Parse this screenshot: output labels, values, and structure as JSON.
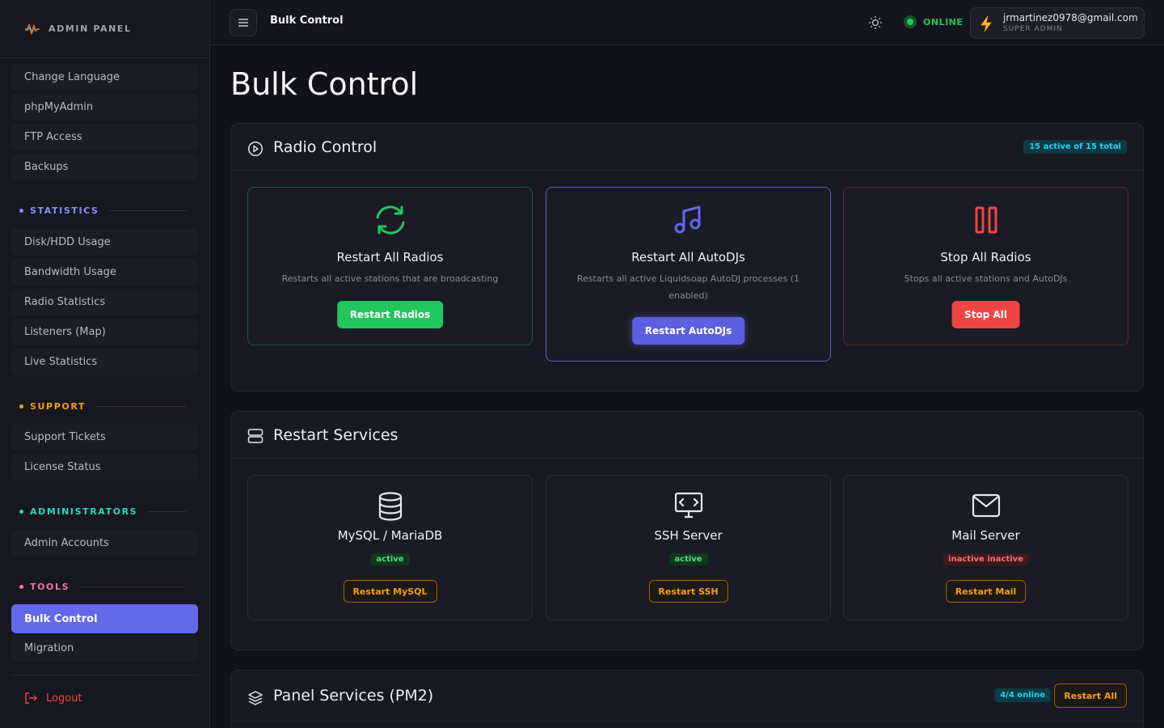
{
  "sidebar": {
    "brand": "ADMIN PANEL",
    "items_top": [
      "Change Language",
      "phpMyAdmin",
      "FTP Access",
      "Backups"
    ],
    "sections": {
      "statistics": {
        "label": "STATISTICS",
        "color": "#8b8ff5",
        "items": [
          "Disk/HDD Usage",
          "Bandwidth Usage",
          "Radio Statistics",
          "Listeners (Map)",
          "Live Statistics"
        ]
      },
      "support": {
        "label": "SUPPORT",
        "color": "#f59e0b",
        "items": [
          "Support Tickets",
          "License Status"
        ]
      },
      "administrators": {
        "label": "ADMINISTRATORS",
        "color": "#2dd4bf",
        "items": [
          "Admin Accounts"
        ]
      },
      "tools": {
        "label": "TOOLS",
        "color": "#f472b6",
        "items": [
          "Bulk Control",
          "Migration"
        ]
      }
    },
    "logout": "Logout"
  },
  "topbar": {
    "title": "Bulk Control",
    "status": "ONLINE",
    "user_email": "jrmartinez0978@gmail.com",
    "user_role": "SUPER ADMIN"
  },
  "page": {
    "title": "Bulk Control"
  },
  "radio_control": {
    "title": "Radio Control",
    "badge": "15 active of 15 total",
    "cards": [
      {
        "title": "Restart All Radios",
        "desc": "Restarts all active stations that are broadcasting",
        "button": "Restart Radios",
        "icon": "refresh-icon",
        "accent": "#22c55e"
      },
      {
        "title": "Restart All AutoDJs",
        "desc": "Restarts all active Liquidsoap AutoDJ processes (1 enabled)",
        "button": "Restart AutoDJs",
        "icon": "music-note-icon",
        "accent": "#6366f1"
      },
      {
        "title": "Stop All Radios",
        "desc": "Stops all active stations and AutoDJs",
        "button": "Stop All",
        "icon": "pause-icon",
        "accent": "#ef4444"
      }
    ]
  },
  "restart_services": {
    "title": "Restart Services",
    "cards": [
      {
        "title": "MySQL / MariaDB",
        "status": "active",
        "button": "Restart MySQL",
        "icon": "database-icon"
      },
      {
        "title": "SSH Server",
        "status": "active",
        "button": "Restart SSH",
        "icon": "terminal-icon"
      },
      {
        "title": "Mail Server",
        "status": "inactive inactive",
        "button": "Restart Mail",
        "icon": "mail-icon"
      }
    ]
  },
  "panel_services": {
    "title": "Panel Services (PM2)",
    "badge": "4/4 online",
    "button": "Restart All"
  }
}
